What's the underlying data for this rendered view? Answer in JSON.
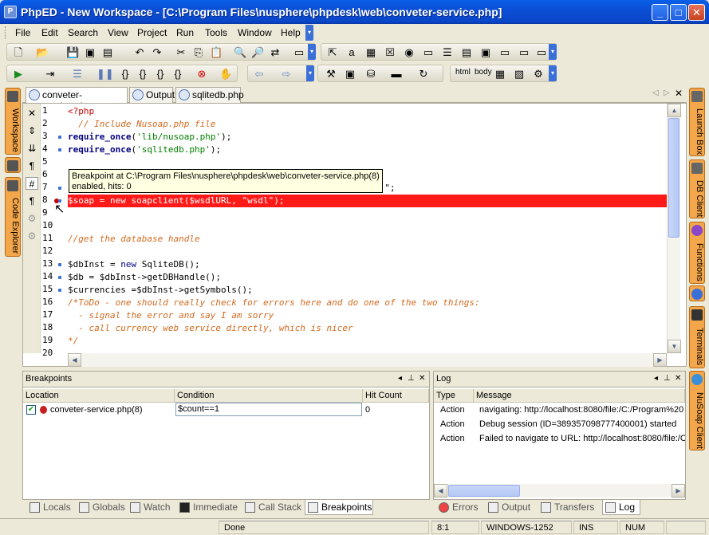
{
  "window": {
    "title": "PhpED - New Workspace - [C:\\Program Files\\nusphere\\phpdesk\\web\\conveter-service.php]",
    "app_icon": "phped-icon",
    "buttons": [
      "minimize",
      "maximize",
      "close"
    ]
  },
  "menu": [
    {
      "label": "File"
    },
    {
      "label": "Edit"
    },
    {
      "label": "Search"
    },
    {
      "label": "View"
    },
    {
      "label": "Project"
    },
    {
      "label": "Run"
    },
    {
      "label": "Tools"
    },
    {
      "label": "Window"
    },
    {
      "label": "Help"
    }
  ],
  "toolbar": {
    "html_label": "html",
    "body_label": "body"
  },
  "left_tabs": [
    {
      "label": "Workspace"
    },
    {
      "label": "Code Explorer"
    }
  ],
  "right_tabs": [
    {
      "label": "Launch Box"
    },
    {
      "label": "DB Client"
    },
    {
      "label": "Functions"
    },
    {
      "label": "Terminals"
    },
    {
      "label": "NuSoap Client"
    }
  ],
  "doc_tabs": [
    {
      "label": "conveter-service.php",
      "active": true
    },
    {
      "label": "Output",
      "active": false
    },
    {
      "label": "sqlitedb.php",
      "active": false
    }
  ],
  "editor": {
    "lines": [
      {
        "n": "1",
        "text": "<?php",
        "cls": "ph",
        "mark": false
      },
      {
        "n": "2",
        "text": "  // Include Nusoap.php file",
        "cls": "cm",
        "mark": false
      },
      {
        "n": "3",
        "text": "require_once('lib/nusoap.php');",
        "cls": "mix3",
        "mark": true
      },
      {
        "n": "4",
        "text": "require_once('sqlitedb.php');",
        "cls": "mix4",
        "mark": true
      },
      {
        "n": "5",
        "text": "",
        "cls": "",
        "mark": false
      },
      {
        "n": "6",
        "text": "",
        "cls": "",
        "mark": false
      },
      {
        "n": "7",
        "text": "                                                asmx?wsdl   \";",
        "cls": "mix7",
        "mark": true
      },
      {
        "n": "8",
        "text": "$soap = new soapclient($wsdlURL, \"wsdl\");",
        "cls": "hl",
        "mark": false
      },
      {
        "n": "9",
        "text": "",
        "cls": "",
        "mark": false
      },
      {
        "n": "10",
        "text": "",
        "cls": "",
        "mark": false
      },
      {
        "n": "11",
        "text": "//get the database handle",
        "cls": "cm",
        "mark": false
      },
      {
        "n": "12",
        "text": "",
        "cls": "",
        "mark": false
      },
      {
        "n": "13",
        "text": "$dbInst = new SqliteDB();",
        "cls": "mix13",
        "mark": true
      },
      {
        "n": "14",
        "text": "$db = $dbInst->getDBHandle();",
        "cls": "plain",
        "mark": true
      },
      {
        "n": "15",
        "text": "$currencies =$dbInst->getSymbols();",
        "cls": "plain",
        "mark": true
      },
      {
        "n": "16",
        "text": "/*ToDo - one should really check for errors here and do one of the two things:",
        "cls": "cm",
        "mark": false
      },
      {
        "n": "17",
        "text": "  - signal the error and say I am sorry",
        "cls": "cm",
        "mark": false
      },
      {
        "n": "18",
        "text": "  - call currency web service directly, which is nicer",
        "cls": "cm",
        "mark": false
      },
      {
        "n": "19",
        "text": "*/",
        "cls": "cm",
        "mark": false
      },
      {
        "n": "20",
        "text": "",
        "cls": "",
        "mark": false
      }
    ],
    "tooltip_line1": "Breakpoint at C:\\Program Files\\nusphere\\phpdesk\\web\\conveter-service.php(8)",
    "tooltip_line2": "enabled, hits: 0"
  },
  "breakpoints_panel": {
    "title": "Breakpoints",
    "columns": [
      "Location",
      "Condition",
      "Hit Count"
    ],
    "rows": [
      {
        "location": "conveter-service.php(8)",
        "condition": "$count==1",
        "hit_count": "0",
        "enabled": true
      }
    ]
  },
  "log_panel": {
    "title": "Log",
    "columns": [
      "Type",
      "Message"
    ],
    "rows": [
      {
        "type": "Action",
        "message": "navigating: http://localhost:8080/file:/C:/Program%20"
      },
      {
        "type": "Action",
        "message": "Debug session  (ID=389357098777400001) started"
      },
      {
        "type": "Action",
        "message": "Failed to navigate to URL: http://localhost:8080/file:/C"
      }
    ]
  },
  "bottom_tabs_left": [
    {
      "label": "Locals"
    },
    {
      "label": "Globals"
    },
    {
      "label": "Watch"
    },
    {
      "label": "Immediate"
    },
    {
      "label": "Call Stack"
    },
    {
      "label": "Breakpoints",
      "active": true
    }
  ],
  "bottom_tabs_right": [
    {
      "label": "Errors"
    },
    {
      "label": "Output"
    },
    {
      "label": "Transfers"
    },
    {
      "label": "Log",
      "active": true
    }
  ],
  "status": {
    "message": "Done",
    "position": "8:1",
    "encoding": "WINDOWS-1252",
    "ins": "INS",
    "num": "NUM"
  }
}
